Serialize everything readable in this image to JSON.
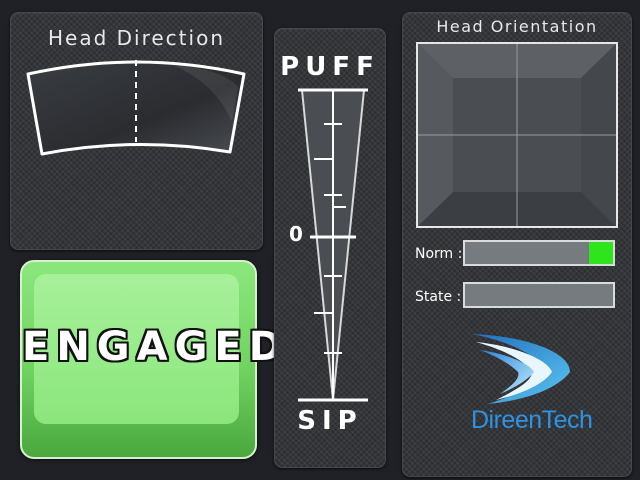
{
  "head_direction": {
    "title": "Head Direction"
  },
  "breath": {
    "top_label": "PUFF",
    "bottom_label": "SIP",
    "zero_label": "0"
  },
  "engaged_button": {
    "label": "ENGAGED"
  },
  "head_orientation": {
    "title": "Head Orientation",
    "norm_label": "Norm :",
    "state_label": "State :",
    "norm_indicator_color": "#2ee51c"
  },
  "brand": {
    "name": "DireenTech",
    "logo_icon": "swoosh-logo-icon",
    "color": "#2e93e2"
  }
}
